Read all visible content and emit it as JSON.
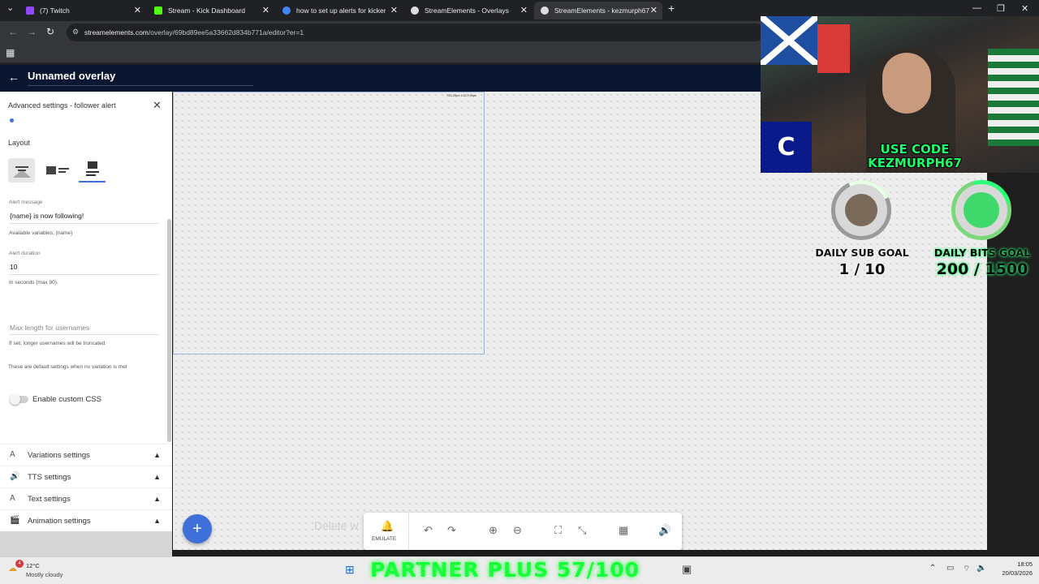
{
  "browser": {
    "tabs": [
      {
        "title": "(7) Twitch",
        "icon_color": "#9146ff"
      },
      {
        "title": "Stream - Kick Dashboard",
        "icon_color": "#53fc18"
      },
      {
        "title": "how to set up alerts for kickers",
        "icon_color": "#4285f4"
      },
      {
        "title": "StreamElements - Overlays",
        "icon_color": "#dddddd"
      },
      {
        "title": "StreamElements - kezmurph67",
        "icon_color": "#dddddd"
      }
    ],
    "active_tab": 4,
    "url_host": "streamelements.com",
    "url_path": "/overlay/69bd89ee5a33662d834b771a/editor?er=1"
  },
  "editor": {
    "title": "Unnamed overlay",
    "canvas_size_label": "733.20px x 617.80px",
    "delete_hint": "Delete w"
  },
  "panel": {
    "header": "Advanced settings - follower alert",
    "layout_label": "Layout",
    "alert_message_label": "Alert message",
    "alert_message_value": "{name} is now following!",
    "available_variables": "Available variables: {name}",
    "alert_duration_label": "Alert duration",
    "alert_duration_value": "10",
    "duration_hint": "In seconds (max 90).",
    "max_length_label": "Max length for usernames",
    "max_length_hint": "If set, longer usernames will be truncated",
    "default_note": "These are default settings when no variation is met",
    "custom_css_label": "Enable custom CSS",
    "accordions": [
      {
        "label": "Variations settings",
        "icon": "A"
      },
      {
        "label": "TTS settings",
        "icon": "🔊"
      },
      {
        "label": "Text settings",
        "icon": "A"
      },
      {
        "label": "Animation settings",
        "icon": "🎬"
      }
    ]
  },
  "toolbar": {
    "emulate_label": "EMULATE"
  },
  "overlay": {
    "logo_letter": "C",
    "promo_line1": "USE CODE",
    "promo_line2": "KEZMURPH67",
    "sub_goal_title": "DAILY SUB GOAL",
    "sub_goal_value": "1 / 10",
    "bits_goal_title": "DAILY BITS GOAL",
    "bits_goal_value": "200 / 1500",
    "partner_text": "PARTNER PLUS 57/100"
  },
  "taskbar": {
    "weather_temp": "12°C",
    "weather_desc": "Mostly cloudy",
    "notification_count": "4",
    "time": "18:05",
    "date": "20/03/2026"
  },
  "colors": {
    "accent": "#3f6fd8",
    "header_bg": "#0b1730",
    "goal_glow": "#2cff7a"
  }
}
